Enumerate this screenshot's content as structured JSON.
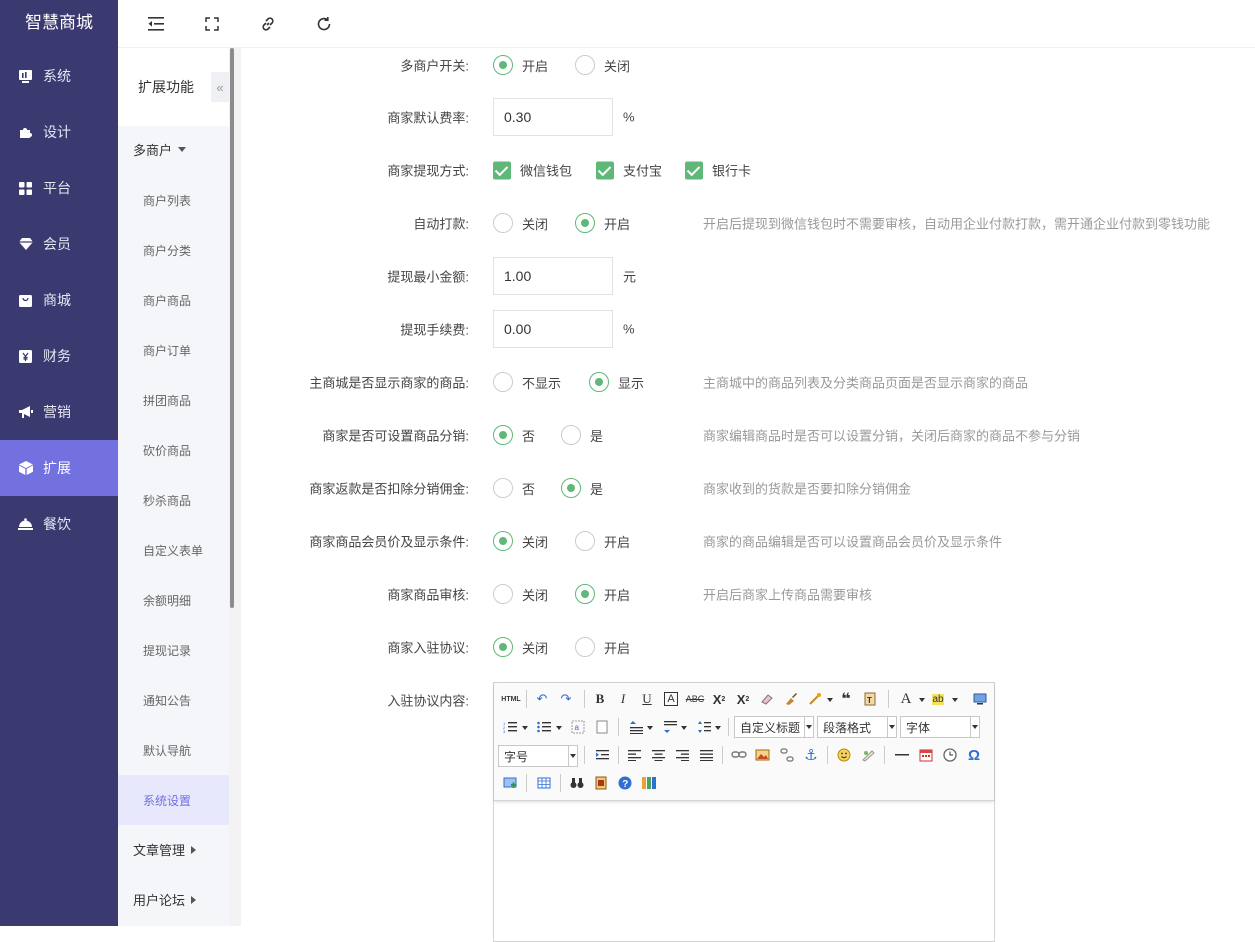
{
  "brand": "智慧商城",
  "colors": {
    "sidebar_bg": "#3a3970",
    "accent": "#7370e0",
    "green": "#5fb878"
  },
  "sidebar": {
    "items": [
      {
        "label": "系统",
        "icon": "system-icon"
      },
      {
        "label": "设计",
        "icon": "puzzle-icon"
      },
      {
        "label": "平台",
        "icon": "grid-icon"
      },
      {
        "label": "会员",
        "icon": "gem-icon"
      },
      {
        "label": "商城",
        "icon": "bag-icon"
      },
      {
        "label": "财务",
        "icon": "yen-icon"
      },
      {
        "label": "营销",
        "icon": "megaphone-icon"
      },
      {
        "label": "扩展",
        "icon": "cube-icon",
        "active": true
      },
      {
        "label": "餐饮",
        "icon": "cloche-icon"
      }
    ]
  },
  "subbar": {
    "title": "扩展功能",
    "collapse_label": "«",
    "group_open": "多商户",
    "items": [
      "商户列表",
      "商户分类",
      "商户商品",
      "商户订单",
      "拼团商品",
      "砍价商品",
      "秒杀商品",
      "自定义表单",
      "余额明细",
      "提现记录",
      "通知公告",
      "默认导航",
      "系统设置"
    ],
    "active_item": "系统设置",
    "groups_closed": [
      "文章管理",
      "用户论坛"
    ]
  },
  "topbar": {
    "icons": [
      "menu-fold-icon",
      "fullscreen-icon",
      "link-icon",
      "refresh-icon"
    ]
  },
  "form": {
    "multi_merchant": {
      "label": "多商户开关:",
      "options": [
        "开启",
        "关闭"
      ],
      "selected": "开启"
    },
    "fee_rate": {
      "label": "商家默认费率:",
      "value": "0.30",
      "unit": "%"
    },
    "withdraw_methods": {
      "label": "商家提现方式:",
      "options": [
        "微信钱包",
        "支付宝",
        "银行卡"
      ]
    },
    "auto_pay": {
      "label": "自动打款:",
      "options": [
        "关闭",
        "开启"
      ],
      "selected": "开启",
      "hint": "开启后提现到微信钱包时不需要审核，自动用企业付款打款，需开通企业付款到零钱功能"
    },
    "min_withdraw": {
      "label": "提现最小金额:",
      "value": "1.00",
      "unit": "元"
    },
    "withdraw_fee": {
      "label": "提现手续费:",
      "value": "0.00",
      "unit": "%"
    },
    "show_merchant_goods": {
      "label": "主商城是否显示商家的商品:",
      "options": [
        "不显示",
        "显示"
      ],
      "selected": "显示",
      "hint": "主商城中的商品列表及分类商品页面是否显示商家的商品"
    },
    "merchant_distribution": {
      "label": "商家是否可设置商品分销:",
      "options": [
        "否",
        "是"
      ],
      "selected": "否",
      "hint": "商家编辑商品时是否可以设置分销，关闭后商家的商品不参与分销"
    },
    "deduct_commission": {
      "label": "商家返款是否扣除分销佣金:",
      "options": [
        "否",
        "是"
      ],
      "selected": "是",
      "hint": "商家收到的货款是否要扣除分销佣金"
    },
    "member_price": {
      "label": "商家商品会员价及显示条件:",
      "options": [
        "关闭",
        "开启"
      ],
      "selected": "关闭",
      "hint": "商家的商品编辑是否可以设置商品会员价及显示条件"
    },
    "goods_review": {
      "label": "商家商品审核:",
      "options": [
        "关闭",
        "开启"
      ],
      "selected": "开启",
      "hint": "开启后商家上传商品需要审核"
    },
    "agreement": {
      "label": "商家入驻协议:",
      "options": [
        "关闭",
        "开启"
      ],
      "selected": "关闭"
    },
    "agreement_content": {
      "label": "入驻协议内容:"
    }
  },
  "editor": {
    "html_label": "HTML",
    "combos": [
      "自定义标题",
      "段落格式",
      "字体",
      "字号"
    ],
    "tool_icons": [
      "undo-icon",
      "redo-icon",
      "bold-icon",
      "italic-icon",
      "underline-icon",
      "border-a-icon",
      "strikethrough-icon",
      "superscript-icon",
      "subscript-icon",
      "eraser-icon",
      "format-brush-icon",
      "auto-format-icon",
      "blockquote-icon",
      "paste-plain-icon",
      "font-color-icon",
      "highlight-icon",
      "preview-icon",
      "ordered-list-icon",
      "unordered-list-icon",
      "select-all-icon",
      "clear-doc-icon",
      "row-spacing-top-icon",
      "row-spacing-bottom-icon",
      "line-height-icon",
      "indent-icon",
      "align-left-icon",
      "align-center-icon",
      "align-right-icon",
      "align-justify-icon",
      "link-icon",
      "image-icon",
      "unlink-icon",
      "anchor-icon",
      "emotion-icon",
      "scrawl-icon",
      "horizontal-rule-icon",
      "date-icon",
      "time-icon",
      "special-char-icon",
      "insert-image-icon",
      "table-icon",
      "search-replace-icon",
      "template-icon",
      "help-icon",
      "ocr-icon"
    ]
  }
}
